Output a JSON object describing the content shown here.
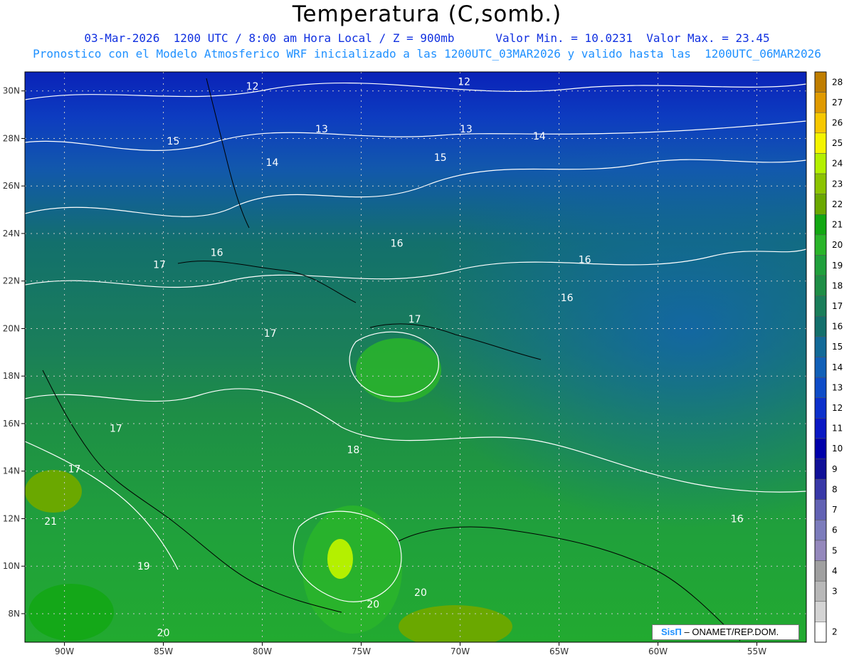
{
  "header": {
    "title": "Temperatura (C,somb.)",
    "line1": "03-Mar-2026  1200 UTC / 8:00 am Hora Local / Z = 900mb      Valor Min. = 10.0231  Valor Max. = 23.45",
    "line2": "Pronostico con el Modelo Atmosferico WRF inicializado a las 1200UTC_03MAR2026 y valido hasta las  1200UTC_06MAR2026"
  },
  "map": {
    "lon_range": [
      -92,
      -52.5
    ],
    "lat_range": [
      6.8,
      30.8
    ],
    "lon_ticks": [
      {
        "lon": -90,
        "label": "90W"
      },
      {
        "lon": -85,
        "label": "85W"
      },
      {
        "lon": -80,
        "label": "80W"
      },
      {
        "lon": -75,
        "label": "75W"
      },
      {
        "lon": -70,
        "label": "70W"
      },
      {
        "lon": -65,
        "label": "65W"
      },
      {
        "lon": -60,
        "label": "60W"
      },
      {
        "lon": -55,
        "label": "55W"
      }
    ],
    "lat_ticks": [
      {
        "lat": 30,
        "label": "30N"
      },
      {
        "lat": 28,
        "label": "28N"
      },
      {
        "lat": 26,
        "label": "26N"
      },
      {
        "lat": 24,
        "label": "24N"
      },
      {
        "lat": 22,
        "label": "22N"
      },
      {
        "lat": 20,
        "label": "20N"
      },
      {
        "lat": 18,
        "label": "18N"
      },
      {
        "lat": 16,
        "label": "16N"
      },
      {
        "lat": 14,
        "label": "14N"
      },
      {
        "lat": 12,
        "label": "12N"
      },
      {
        "lat": 10,
        "label": "10N"
      },
      {
        "lat": 8,
        "label": "8N"
      }
    ],
    "contour_labels": [
      {
        "text": "12",
        "lon": -80.5,
        "lat": 30.2
      },
      {
        "text": "12",
        "lon": -69.8,
        "lat": 30.4
      },
      {
        "text": "13",
        "lon": -77.0,
        "lat": 28.4
      },
      {
        "text": "13",
        "lon": -69.7,
        "lat": 28.4
      },
      {
        "text": "14",
        "lon": -66.0,
        "lat": 28.1
      },
      {
        "text": "15",
        "lon": -84.5,
        "lat": 27.9
      },
      {
        "text": "15",
        "lon": -71.0,
        "lat": 27.2
      },
      {
        "text": "14",
        "lon": -79.5,
        "lat": 27.0
      },
      {
        "text": "16",
        "lon": -73.2,
        "lat": 23.6
      },
      {
        "text": "16",
        "lon": -82.3,
        "lat": 23.2
      },
      {
        "text": "16",
        "lon": -63.7,
        "lat": 22.9
      },
      {
        "text": "17",
        "lon": -85.2,
        "lat": 22.7
      },
      {
        "text": "16",
        "lon": -64.6,
        "lat": 21.3
      },
      {
        "text": "17",
        "lon": -72.3,
        "lat": 20.4
      },
      {
        "text": "17",
        "lon": -79.6,
        "lat": 19.8
      },
      {
        "text": "17",
        "lon": -87.4,
        "lat": 15.8
      },
      {
        "text": "18",
        "lon": -75.4,
        "lat": 14.9
      },
      {
        "text": "17",
        "lon": -89.5,
        "lat": 14.1
      },
      {
        "text": "16",
        "lon": -56.0,
        "lat": 12.0
      },
      {
        "text": "21",
        "lon": -90.7,
        "lat": 11.9
      },
      {
        "text": "19",
        "lon": -86.0,
        "lat": 10.0
      },
      {
        "text": "20",
        "lon": -72.0,
        "lat": 8.9
      },
      {
        "text": "20",
        "lon": -74.4,
        "lat": 8.4
      },
      {
        "text": "20",
        "lon": -85.0,
        "lat": 7.2
      }
    ]
  },
  "colorbar": {
    "levels": [
      {
        "label": "28",
        "color": "#c07e00"
      },
      {
        "label": "27",
        "color": "#e09a00"
      },
      {
        "label": "26",
        "color": "#f7c800"
      },
      {
        "label": "25",
        "color": "#f4f400"
      },
      {
        "label": "24",
        "color": "#b4f000"
      },
      {
        "label": "23",
        "color": "#8cc400"
      },
      {
        "label": "22",
        "color": "#6aa800"
      },
      {
        "label": "21",
        "color": "#12a812"
      },
      {
        "label": "20",
        "color": "#2ab52a"
      },
      {
        "label": "19",
        "color": "#20a03c"
      },
      {
        "label": "18",
        "color": "#1e8e46"
      },
      {
        "label": "17",
        "color": "#1a7e5a"
      },
      {
        "label": "16",
        "color": "#13706c"
      },
      {
        "label": "15",
        "color": "#126a98"
      },
      {
        "label": "14",
        "color": "#1160b8"
      },
      {
        "label": "13",
        "color": "#0e4cc8"
      },
      {
        "label": "12",
        "color": "#0c30cc"
      },
      {
        "label": "11",
        "color": "#0a18c4"
      },
      {
        "label": "10",
        "color": "#0000aa"
      },
      {
        "label": "9",
        "color": "#101098"
      },
      {
        "label": "8",
        "color": "#3838a8"
      },
      {
        "label": "7",
        "color": "#6262b4"
      },
      {
        "label": "6",
        "color": "#7c7cbc"
      },
      {
        "label": "5",
        "color": "#9488bc"
      },
      {
        "label": "4",
        "color": "#a0a0a0"
      },
      {
        "label": "3",
        "color": "#b8b8b8"
      },
      {
        "label": "",
        "color": "#d4d4d4"
      },
      {
        "label": "2",
        "color": "#ffffff"
      }
    ]
  },
  "credit": {
    "brand": "SisΠ",
    "text": " – ONAMET/REP.DOM."
  }
}
